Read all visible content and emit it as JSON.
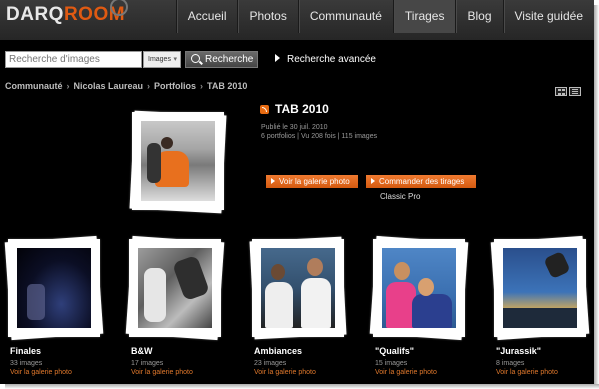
{
  "logo": {
    "part1": "DARQ",
    "part2": "ROOM"
  },
  "nav": [
    "Accueil",
    "Photos",
    "Communauté",
    "Tirages",
    "Blog",
    "Visite guidée"
  ],
  "search": {
    "placeholder": "Recherche d'images",
    "select": "Images",
    "button": "Recherche",
    "advanced": "Recherche avancée"
  },
  "breadcrumb": [
    "Communauté",
    "Nicolas Laureau",
    "Portfolios",
    "TAB 2010"
  ],
  "album": {
    "title": "TAB 2010",
    "published": "Publié le 30 juil. 2010",
    "stats": "6 portfolios  |  Vu 208 fois  |  115 images",
    "btn_gallery": "Voir la galerie photo",
    "btn_order": "Commander des tirages",
    "order_sub": "Classic Pro"
  },
  "galleries": [
    {
      "title": "Finales",
      "count": "33 images",
      "link": "Voir la galerie photo"
    },
    {
      "title": "B&W",
      "count": "17 images",
      "link": "Voir la galerie photo"
    },
    {
      "title": "Ambiances",
      "count": "23 images",
      "link": "Voir la galerie photo"
    },
    {
      "title": "\"Qualifs\"",
      "count": "15 images",
      "link": "Voir la galerie photo"
    },
    {
      "title": "\"Jurassik\"",
      "count": "8 images",
      "link": "Voir la galerie photo"
    }
  ],
  "colors": {
    "accent": "#e05a12",
    "button": "#e06a20",
    "link": "#e0782c"
  },
  "icons": [
    "search-icon",
    "rss-icon",
    "grid-view-icon",
    "list-view-icon"
  ]
}
